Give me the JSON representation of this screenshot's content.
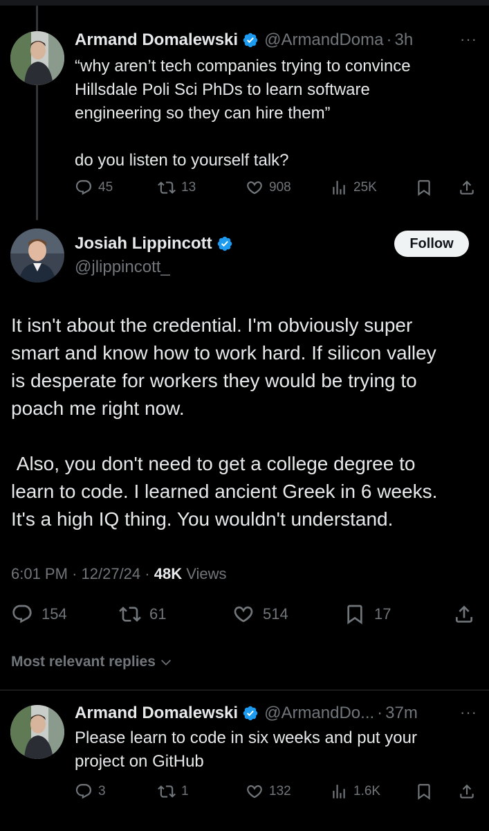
{
  "tweet1": {
    "name": "Armand Domalewski",
    "handle": "@ArmandDoma",
    "time": "3h",
    "text": "“why aren’t tech companies trying to convince\nHillsdale Poli Sci PhDs to learn software\nengineering so they can hire them”\n\ndo you listen to yourself talk?",
    "replies": "45",
    "reposts": "13",
    "likes": "908",
    "views": "25K"
  },
  "main_tweet": {
    "name": "Josiah Lippincott",
    "handle": "@jlippincott_",
    "follow_label": "Follow",
    "text": "It isn't about the credential. I'm obviously super\nsmart and know how to work hard. If silicon valley\nis desperate for workers they would be trying to\npoach me right now.\n\n Also, you don't need to get a college degree to\nlearn to code. I learned ancient Greek in 6 weeks.\nIt's a high IQ thing. You wouldn't understand.",
    "time": "6:01 PM",
    "date": "12/27/24",
    "views_count": "48K",
    "views_label": "Views",
    "replies": "154",
    "reposts": "61",
    "likes": "514",
    "bookmarks": "17"
  },
  "replies_sort_label": "Most relevant replies",
  "tweet3": {
    "name": "Armand Domalewski",
    "handle": "@ArmandDo...",
    "time": "37m",
    "text": "Please learn to code in six weeks and put your\nproject on GitHub",
    "replies": "3",
    "reposts": "1",
    "likes": "132",
    "views": "1.6K"
  },
  "colors": {
    "background": "#000000",
    "text": "#e7e9ea",
    "muted": "#71767b",
    "verified": "#1d9bf0",
    "follow_bg": "#eff3f4"
  },
  "icons": [
    "reply-icon",
    "repost-icon",
    "like-icon",
    "views-icon",
    "bookmark-icon",
    "share-icon",
    "verified-icon",
    "more-icon",
    "chevron-down-icon"
  ]
}
